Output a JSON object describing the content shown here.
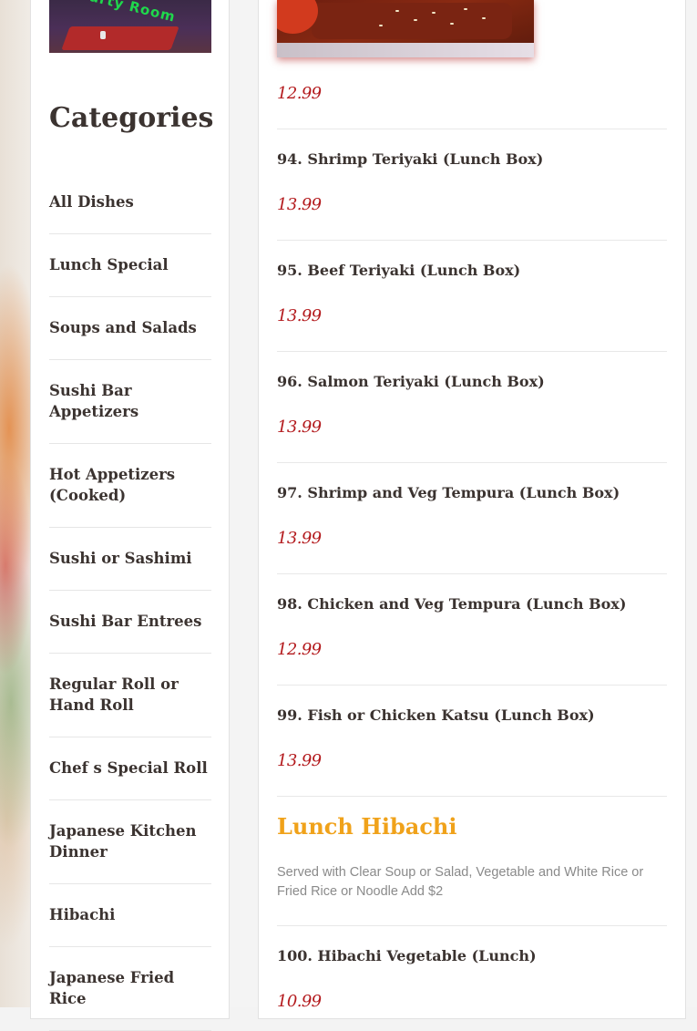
{
  "sidebar": {
    "party_image_caption": "Party Room",
    "categories_title": "Categories",
    "categories": [
      "All Dishes",
      "Lunch Special",
      "Soups and Salads",
      "Sushi Bar Appetizers",
      "Hot Appetizers (Cooked)",
      "Sushi or Sashimi",
      "Sushi Bar Entrees",
      "Regular Roll or Hand Roll",
      "Chef s Special Roll",
      "Japanese Kitchen Dinner",
      "Hibachi",
      "Japanese Fried Rice"
    ]
  },
  "main": {
    "top_price": "12.99",
    "dishes": [
      {
        "name": "94. Shrimp Teriyaki (Lunch Box)",
        "price": "13.99"
      },
      {
        "name": "95. Beef Teriyaki (Lunch Box)",
        "price": "13.99"
      },
      {
        "name": "96. Salmon Teriyaki (Lunch Box)",
        "price": "13.99"
      },
      {
        "name": "97. Shrimp and Veg Tempura (Lunch Box)",
        "price": "13.99"
      },
      {
        "name": "98. Chicken and Veg Tempura (Lunch Box)",
        "price": "12.99"
      },
      {
        "name": "99. Fish or Chicken Katsu (Lunch Box)",
        "price": "13.99"
      }
    ],
    "section": {
      "title": "Lunch Hibachi",
      "description": "Served with Clear Soup or Salad, Vegetable and White Rice or Fried Rice or Noodle Add $2"
    },
    "next_dish": {
      "name": "100. Hibachi Vegetable (Lunch)",
      "price": "10.99"
    }
  },
  "colors": {
    "price": "#b3191c",
    "section_title": "#f0a21a",
    "text": "#3b3330"
  }
}
